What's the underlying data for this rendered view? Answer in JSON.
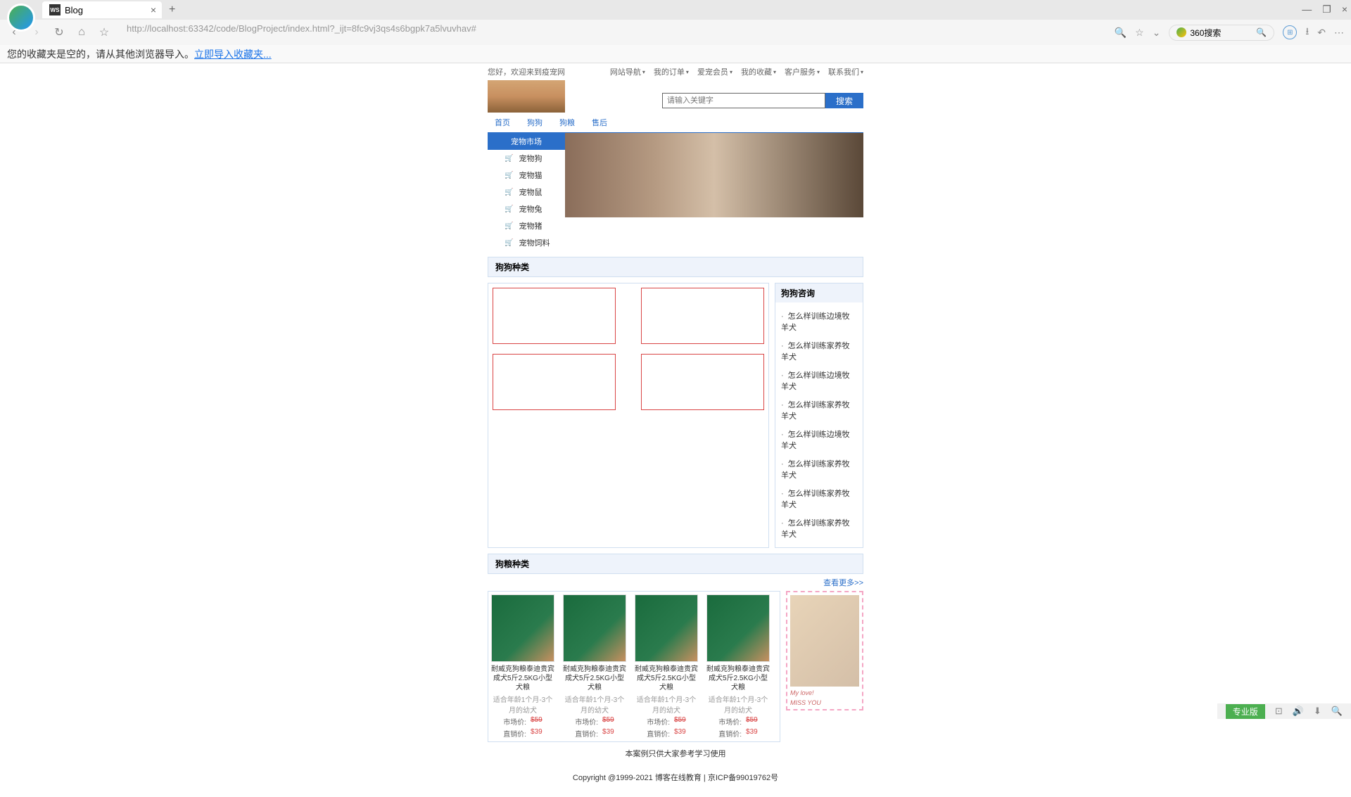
{
  "browser": {
    "tab_title": "Blog",
    "url_display": "http://localhost:63342/code/BlogProject/index.html?_ijt=8fc9vj3qs4s6bgpk7a5lvuvhav#",
    "search_360_placeholder": "360搜索",
    "bookmark_empty_msg": "您的收藏夹是空的，请从其他浏览器导入。",
    "bookmark_import_link": "立即导入收藏夹...",
    "pro_label": "专业版"
  },
  "top_bar": {
    "welcome": "您好，欢迎来到疫宠网",
    "nav": [
      "网站导航",
      "我的订单",
      "爱宠会员",
      "我的收藏",
      "客户服务",
      "联系我们"
    ]
  },
  "search": {
    "placeholder": "请输入关键字",
    "button": "搜索"
  },
  "main_nav": [
    "首页",
    "狗狗",
    "狗粮",
    "售后"
  ],
  "sidebar": {
    "header": "宠物市场",
    "items": [
      "宠物狗",
      "宠物猫",
      "宠物鼠",
      "宠物兔",
      "宠物猪",
      "宠物饲料"
    ]
  },
  "sections": {
    "dog_breed": "狗狗种类",
    "dog_food": "狗粮种类",
    "dog_consult": "狗狗咨询",
    "view_more": "查看更多>>"
  },
  "consult_items": [
    "怎么样训练边境牧羊犬",
    "怎么样训练家养牧羊犬",
    "怎么样训练边境牧羊犬",
    "怎么样训练家养牧羊犬",
    "怎么样训练边境牧羊犬",
    "怎么样训练家养牧羊犬",
    "怎么样训练家养牧羊犬",
    "怎么样训练家养牧羊犬"
  ],
  "products": [
    {
      "name": "耐威克狗粮泰迪贵宾成犬5斤2.5KG小型犬粮",
      "hint": "适合年龄1个月-3个月的幼犬",
      "market_label": "市场价:",
      "market": "$59",
      "sale_label": "直销价:",
      "sale": "$39"
    },
    {
      "name": "耐威克狗粮泰迪贵宾成犬5斤2.5KG小型犬粮",
      "hint": "适合年龄1个月-3个月的幼犬",
      "market_label": "市场价:",
      "market": "$59",
      "sale_label": "直销价:",
      "sale": "$39"
    },
    {
      "name": "耐威克狗粮泰迪贵宾成犬5斤2.5KG小型犬粮",
      "hint": "适合年龄1个月-3个月的幼犬",
      "market_label": "市场价:",
      "market": "$59",
      "sale_label": "直销价:",
      "sale": "$39"
    },
    {
      "name": "耐威克狗粮泰迪贵宾成犬5斤2.5KG小型犬粮",
      "hint": "适合年龄1个月-3个月的幼犬",
      "market_label": "市场价:",
      "market": "$59",
      "sale_label": "直销价:",
      "sale": "$39"
    }
  ],
  "promo": {
    "line1": "My love!",
    "line2": "MISS YOU"
  },
  "disclaimer": "本案例只供大家参考学习使用",
  "copyright": "Copyright @1999-2021 博客在线教育 | 京ICP备99019762号"
}
